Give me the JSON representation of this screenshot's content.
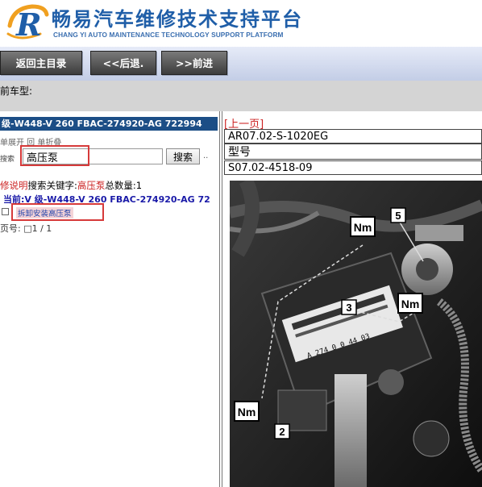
{
  "header": {
    "title": "畅易汽车维修技术支持平台",
    "subtitle": "CHANG YI AUTO MAINTENANCE TECHNOLOGY SUPPORT PLATFORM",
    "logo_letter": "R",
    "brand_color": "#1f5ea8"
  },
  "nav": {
    "home_label": "返回主目录",
    "back_label": "<<后退.",
    "forward_label": ">>前进"
  },
  "vehicle": {
    "label": "前车型:"
  },
  "left": {
    "model_header": "级-W448-V 260 FBAC-274920-AG 722994",
    "menu_links": "单展开  回  单折叠",
    "search_label": "搜索",
    "search_value": "高压泵",
    "search_button": "搜索",
    "search_extra": "..",
    "result_prefix": "修说明",
    "result_keyword_label": "搜索关键字:",
    "result_keyword": "高压泵",
    "result_count_label": "总数量:",
    "result_count": "1",
    "current_path": "当前:V 级-W448-V 260 FBAC-274920-AG 72",
    "result_item": "拆卸安装高压泵",
    "page_info": "页号: □1 / 1"
  },
  "right": {
    "prev_page": "[上一页]",
    "ref_code": "AR07.02-S-1020EG",
    "model_label": "型号",
    "doc_code": "S07.02-4518-09",
    "diagram_labels": {
      "nm": "Nm",
      "callout_2": "2",
      "callout_3": "3",
      "callout_5": "5",
      "sticker_text": "A 274 0 0 44 03"
    }
  },
  "colors": {
    "highlight": "#d63a3a",
    "model_header_bg": "#1c4e86",
    "link": "#1a1aa8",
    "keyword": "#cc2222"
  }
}
